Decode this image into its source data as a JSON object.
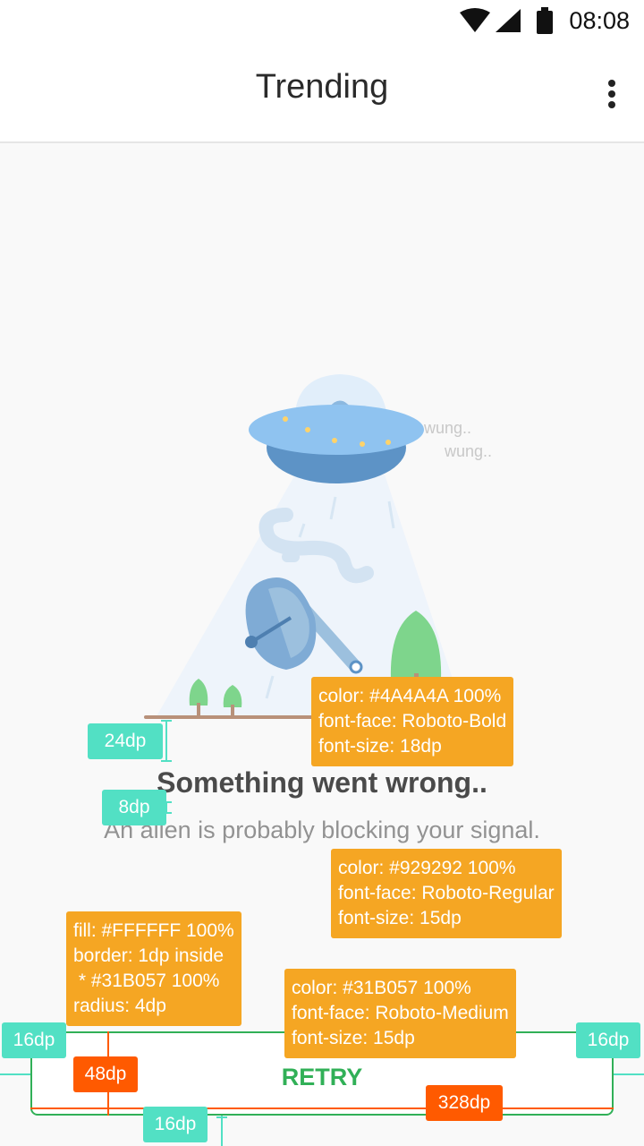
{
  "status_bar": {
    "time": "08:08"
  },
  "app_bar": {
    "title": "Trending"
  },
  "illustration": {
    "sound_1": "wung..",
    "sound_2": "wung.."
  },
  "error": {
    "headline": "Something went wrong..",
    "message": "An alien is probably blocking your signal."
  },
  "retry_button": {
    "label": "RETRY"
  },
  "annotations": {
    "headline_spec": "color: #4A4A4A 100%\nfont-face: Roboto-Bold\nfont-size: 18dp",
    "message_spec": "color: #929292 100%\nfont-face: Roboto-Regular\nfont-size: 15dp",
    "button_spec": "fill: #FFFFFF 100%\nborder: 1dp inside\n * #31B057 100%\nradius: 4dp",
    "label_spec": "color: #31B057 100%\nfont-face: Roboto-Medium\nfont-size: 15dp",
    "gap_top": "24dp",
    "gap_middle": "8dp",
    "margin_left": "16dp",
    "margin_right": "16dp",
    "margin_bottom": "16dp",
    "button_height": "48dp",
    "button_width": "328dp"
  },
  "colors": {
    "headline": "#4A4A4A",
    "message": "#929292",
    "accent": "#31B057",
    "annotation": "#F5A623",
    "measure": "#52E0C4",
    "dimension": "#FF5A00"
  }
}
